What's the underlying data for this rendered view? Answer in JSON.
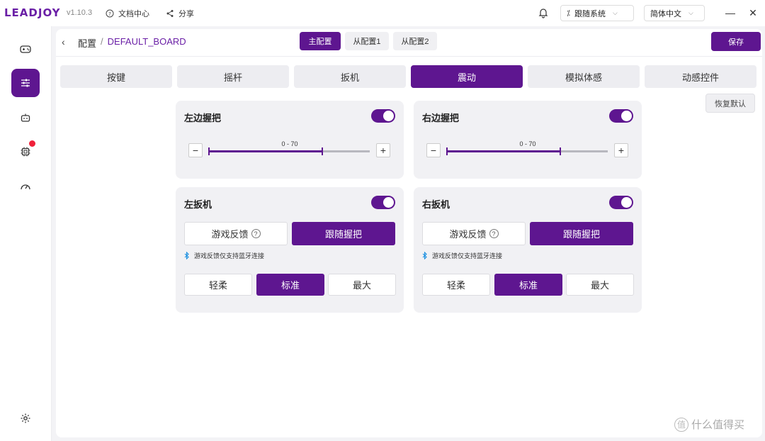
{
  "app": {
    "logo": "LEADJOY",
    "version": "v1.10.3"
  },
  "titlebar": {
    "docs_label": "文档中心",
    "share_label": "分享",
    "system_select": "跟随系统",
    "lang_select": "简体中文"
  },
  "breadcrumb": {
    "root": "配置",
    "separator": "/",
    "current": "DEFAULT_BOARD"
  },
  "config_tabs": [
    "主配置",
    "从配置1",
    "从配置2"
  ],
  "save_label": "保存",
  "tabs": [
    "按键",
    "摇杆",
    "扳机",
    "震动",
    "模拟体感",
    "动感控件"
  ],
  "active_tab": "震动",
  "reset_label": "恢复默认",
  "cards": {
    "left_grip": {
      "title": "左边握把",
      "enabled": true,
      "range_label": "0 - 70",
      "value": 70,
      "max": 100
    },
    "right_grip": {
      "title": "右边握把",
      "enabled": true,
      "range_label": "0 - 70",
      "value": 70,
      "max": 100
    },
    "left_trigger": {
      "title": "左扳机",
      "enabled": true,
      "mode_feedback": "游戏反馈",
      "mode_follow": "跟随握把",
      "mode_selected": "跟随握把",
      "bt_note": "游戏反馈仅支持蓝牙连接",
      "levels": [
        "轻柔",
        "标准",
        "最大"
      ],
      "level_selected": "标准"
    },
    "right_trigger": {
      "title": "右扳机",
      "enabled": true,
      "mode_feedback": "游戏反馈",
      "mode_follow": "跟随握把",
      "mode_selected": "跟随握把",
      "bt_note": "游戏反馈仅支持蓝牙连接",
      "levels": [
        "轻柔",
        "标准",
        "最大"
      ],
      "level_selected": "标准"
    }
  },
  "watermark": "什么值得买",
  "colors": {
    "accent": "#5e1690",
    "badge": "#f0213a"
  },
  "icons": {
    "sidebar": [
      "gamepad-icon",
      "sliders-icon",
      "robot-icon",
      "chip-icon",
      "gauge-icon",
      "settings-icon"
    ]
  }
}
